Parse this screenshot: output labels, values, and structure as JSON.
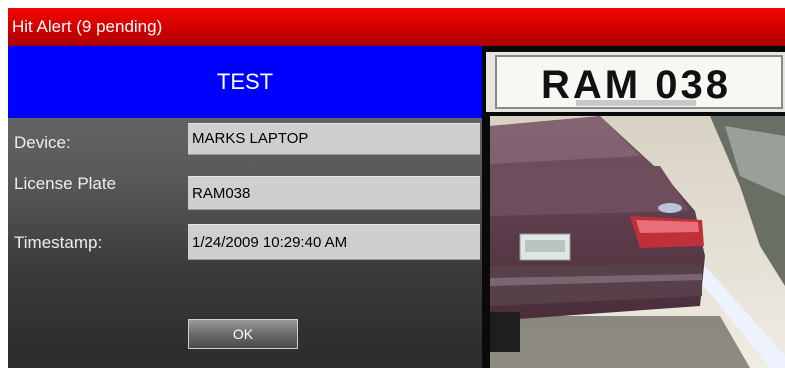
{
  "window": {
    "title": "Hit Alert (9 pending)"
  },
  "alert": {
    "banner": "TEST",
    "fields": [
      {
        "label": "Device:",
        "value": "MARKS LAPTOP"
      },
      {
        "label": "License Plate",
        "value": "RAM038"
      },
      {
        "label": "Timestamp:",
        "value": "1/24/2009 10:29:40 AM"
      }
    ],
    "ok_label": "OK"
  },
  "images": {
    "plate_text": "RAM 038"
  },
  "colors": {
    "titlebar": "#e00000",
    "banner": "#0000ff",
    "field_bg": "#cfcfcf"
  }
}
